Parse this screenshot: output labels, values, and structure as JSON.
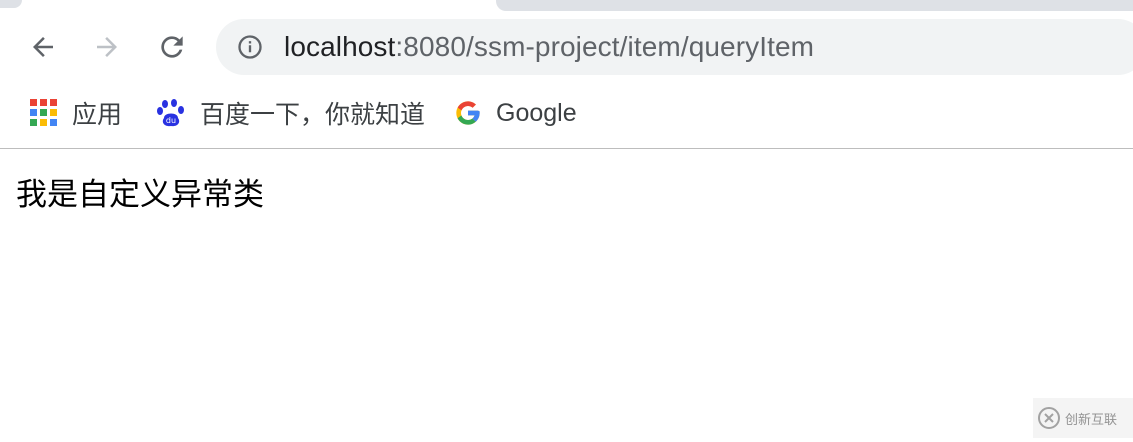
{
  "browser": {
    "url": {
      "host": "localhost",
      "rest": ":8080/ssm-project/item/queryItem"
    },
    "nav_icons": {
      "back": "arrow-left-icon",
      "forward": "arrow-right-icon",
      "reload": "reload-icon",
      "site_info": "info-icon"
    },
    "bookmarks": [
      {
        "label": "应用",
        "icon": "apps-grid-icon"
      },
      {
        "label": "百度一下，你就知道",
        "icon": "baidu-paw-icon"
      },
      {
        "label": "Google",
        "icon": "google-g-icon"
      }
    ]
  },
  "page": {
    "message": "我是自定义异常类"
  },
  "watermark": {
    "text": "创新互联"
  },
  "colors": {
    "omnibox_bg": "#f1f3f4",
    "tab_strip": "#dee1e6",
    "baidu_blue": "#2932e1",
    "text_dark": "#202124",
    "text_muted": "#5f6368"
  }
}
